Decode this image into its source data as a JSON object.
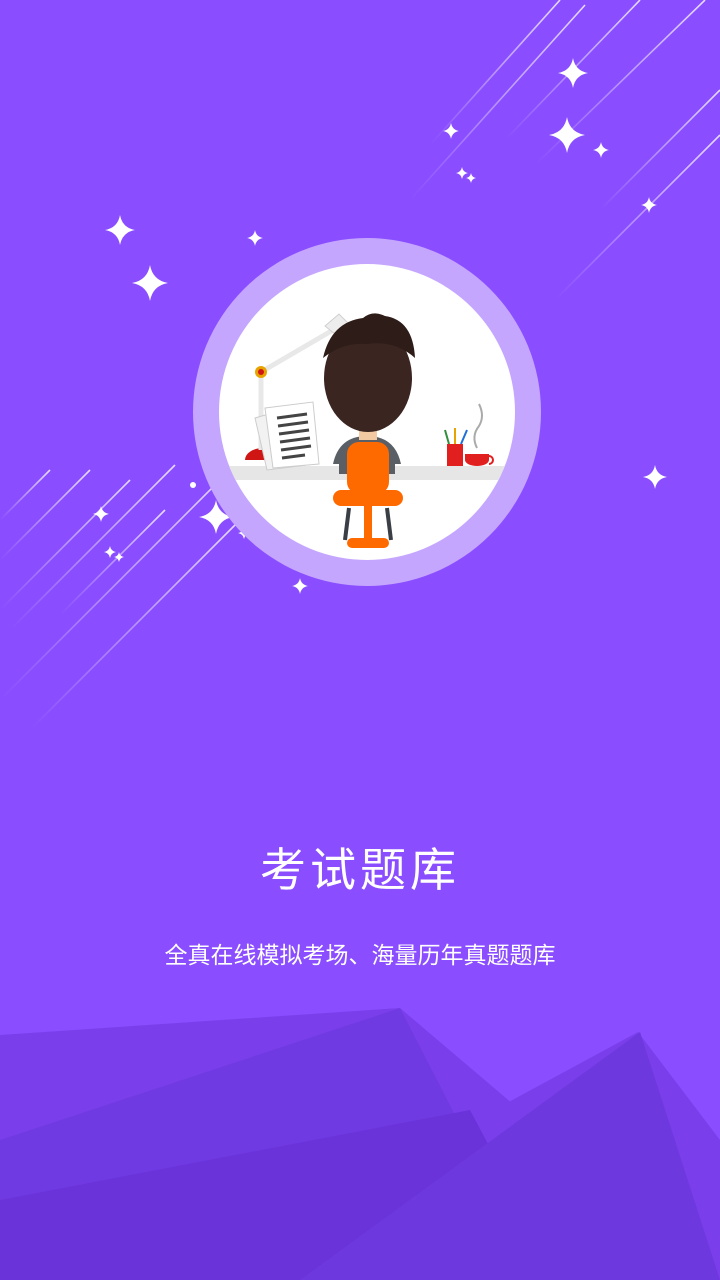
{
  "splash": {
    "title": "考试题库",
    "subtitle": "全真在线模拟考场、海量历年真题题库"
  },
  "colors": {
    "background": "#8a4dff",
    "text": "#ffffff",
    "mountain_light": "#7c40ee",
    "mountain_dark": "#6b32dc",
    "ring": "#c6a7ff",
    "chair": "#ff6a00",
    "hair": "#3a2520"
  },
  "icons": {
    "sparkles": "sparkle-icon",
    "illustration": "student-at-desk-illustration"
  }
}
